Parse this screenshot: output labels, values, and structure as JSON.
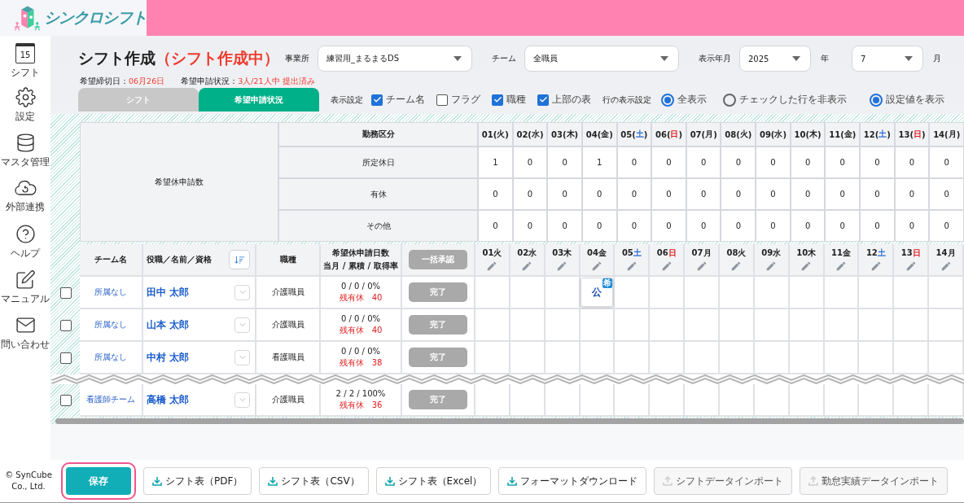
{
  "header": {
    "logo_text": "シンクロシフト"
  },
  "sidebar": [
    {
      "label": "シフト",
      "icon_text": "15"
    },
    {
      "label": "設定"
    },
    {
      "label": "マスタ管理"
    },
    {
      "label": "外部連携"
    },
    {
      "label": "ヘルプ"
    },
    {
      "label": "マニュアル"
    },
    {
      "label": "問い合わせ"
    }
  ],
  "page": {
    "title": "シフト作成",
    "status": "（シフト作成中）",
    "deadline_label": "希望締切日：",
    "deadline": "06月26日",
    "submission_label": "希望申請状況：",
    "submission": "3人/21人中 提出済み"
  },
  "filters": [
    {
      "label": "事業所",
      "value": "練習用_まるまるDS"
    },
    {
      "label": "チーム",
      "value": "全職員"
    },
    {
      "label": "表示年月",
      "value": "2025",
      "unit": "年"
    },
    {
      "value": "7",
      "unit": "月"
    }
  ],
  "tabs": [
    {
      "label": "シフト",
      "selected": false
    },
    {
      "label": "希望申請状況",
      "selected": true
    }
  ],
  "display_settings": {
    "label": "表示設定",
    "options": [
      {
        "label": "チーム名",
        "checked": true
      },
      {
        "label": "フラグ",
        "checked": false
      },
      {
        "label": "職種",
        "checked": true
      },
      {
        "label": "上部の表",
        "checked": true
      }
    ]
  },
  "row_display": {
    "label": "行の表示設定",
    "options": [
      {
        "label": "全表示",
        "selected": true
      },
      {
        "label": "チェックした行を非表示",
        "selected": false
      }
    ]
  },
  "value_display": {
    "label": "設定値を表示",
    "selected": true
  },
  "summary": {
    "row_header": "希望休申請数",
    "category_header": "勤務区分",
    "days": [
      {
        "number": "01",
        "open": "(",
        "weekday": "火",
        "close": ")",
        "kind": "weekday"
      },
      {
        "number": "02",
        "open": "(",
        "weekday": "水",
        "close": ")",
        "kind": "weekday"
      },
      {
        "number": "03",
        "open": "(",
        "weekday": "木",
        "close": ")",
        "kind": "weekday"
      },
      {
        "number": "04",
        "open": "(",
        "weekday": "金",
        "close": ")",
        "kind": "weekday"
      },
      {
        "number": "05",
        "open": "(",
        "weekday": "土",
        "close": ")",
        "kind": "saturday"
      },
      {
        "number": "06",
        "open": "(",
        "weekday": "日",
        "close": ")",
        "kind": "sunday"
      },
      {
        "number": "07",
        "open": "(",
        "weekday": "月",
        "close": ")",
        "kind": "weekday"
      },
      {
        "number": "08",
        "open": "(",
        "weekday": "火",
        "close": ")",
        "kind": "weekday"
      },
      {
        "number": "09",
        "open": "(",
        "weekday": "水",
        "close": ")",
        "kind": "weekday"
      },
      {
        "number": "10",
        "open": "(",
        "weekday": "木",
        "close": ")",
        "kind": "weekday"
      },
      {
        "number": "11",
        "open": "(",
        "weekday": "金",
        "close": ")",
        "kind": "weekday"
      },
      {
        "number": "12",
        "open": "(",
        "weekday": "土",
        "close": ")",
        "kind": "saturday"
      },
      {
        "number": "13",
        "open": "(",
        "weekday": "日",
        "close": ")",
        "kind": "sunday"
      },
      {
        "number": "14",
        "open": "(",
        "weekday": "月",
        "close": ")",
        "kind": "weekday"
      }
    ],
    "rows": [
      {
        "label": "所定休日",
        "values": [
          "1",
          "0",
          "0",
          "1",
          "0",
          "0",
          "0",
          "0",
          "0",
          "0",
          "0",
          "0",
          "0",
          "0"
        ]
      },
      {
        "label": "有休",
        "values": [
          "0",
          "0",
          "0",
          "0",
          "0",
          "0",
          "0",
          "0",
          "0",
          "0",
          "0",
          "0",
          "0",
          "0"
        ]
      },
      {
        "label": "その他",
        "values": [
          "0",
          "0",
          "0",
          "0",
          "0",
          "0",
          "0",
          "0",
          "0",
          "0",
          "0",
          "0",
          "0",
          "0"
        ]
      }
    ]
  },
  "roster": {
    "columns": [
      "チーム名",
      "役職／名前／資格",
      "職種"
    ],
    "count_header": [
      "希望休申請日数",
      "当月 / 累積 / 取得率"
    ],
    "bulk_button": {
      "label": "一括承認",
      "disabled": true
    },
    "days": [
      {
        "number": "01",
        "weekday": "火",
        "kind": "weekday"
      },
      {
        "number": "02",
        "weekday": "水",
        "kind": "weekday"
      },
      {
        "number": "03",
        "weekday": "木",
        "kind": "weekday"
      },
      {
        "number": "04",
        "weekday": "金",
        "kind": "weekday"
      },
      {
        "number": "05",
        "weekday": "土",
        "kind": "saturday"
      },
      {
        "number": "06",
        "weekday": "日",
        "kind": "sunday"
      },
      {
        "number": "07",
        "weekday": "月",
        "kind": "weekday"
      },
      {
        "number": "08",
        "weekday": "火",
        "kind": "weekday"
      },
      {
        "number": "09",
        "weekday": "水",
        "kind": "weekday"
      },
      {
        "number": "10",
        "weekday": "木",
        "kind": "weekday"
      },
      {
        "number": "11",
        "weekday": "金",
        "kind": "weekday"
      },
      {
        "number": "12",
        "weekday": "土",
        "kind": "saturday"
      },
      {
        "number": "13",
        "weekday": "日",
        "kind": "sunday"
      },
      {
        "number": "14",
        "weekday": "月",
        "kind": "weekday"
      }
    ],
    "rows": [
      {
        "checked": false,
        "team": "所属なし",
        "name": "田中 太郎",
        "job": "介護職員",
        "counts": "0 / 0 / 0%",
        "remaining": "残有休　40",
        "action": "完了",
        "action_disabled": true,
        "cells": [
          null,
          null,
          null,
          {
            "label": "公",
            "badge": "希"
          },
          null,
          null,
          null,
          null,
          null,
          null,
          null,
          null,
          null,
          null
        ]
      },
      {
        "checked": false,
        "team": "所属なし",
        "name": "山本 太郎",
        "job": "介護職員",
        "counts": "0 / 0 / 0%",
        "remaining": "残有休　40",
        "action": "完了",
        "action_disabled": true
      },
      {
        "checked": false,
        "team": "所属なし",
        "name": "中村 太郎",
        "job": "看護職員",
        "counts": "0 / 0 / 0%",
        "remaining": "残有休　38",
        "action": "完了",
        "action_disabled": true
      },
      {
        "checked": false,
        "team": "看護師チーム",
        "name": "高橋 太郎",
        "job": "介護職員",
        "counts": "2 / 2 / 100%",
        "remaining": "残有休　36",
        "action": "完了",
        "action_disabled": true
      }
    ]
  },
  "footer": {
    "copyright": "© SynCube Co., Ltd.",
    "buttons": [
      {
        "label": "保存",
        "kind": "primary"
      },
      {
        "label": "シフト表（PDF）",
        "kind": "download",
        "disabled": false
      },
      {
        "label": "シフト表（CSV）",
        "kind": "download",
        "disabled": false
      },
      {
        "label": "シフト表（Excel）",
        "kind": "download",
        "disabled": false
      },
      {
        "label": "フォーマットダウンロード",
        "kind": "download",
        "disabled": false
      },
      {
        "label": "シフトデータインポート",
        "kind": "upload",
        "disabled": true
      },
      {
        "label": "勤怠実績データインポート",
        "kind": "upload",
        "disabled": true
      }
    ]
  }
}
